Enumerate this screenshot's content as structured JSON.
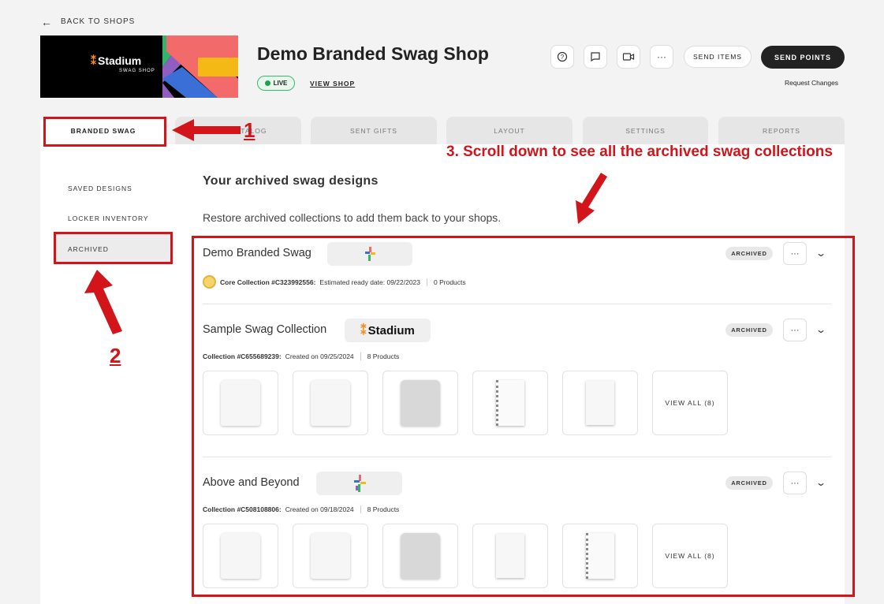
{
  "nav": {
    "back_label": "BACK TO SHOPS"
  },
  "shop": {
    "title": "Demo Branded Swag Shop",
    "status": "LIVE",
    "view_shop": "VIEW SHOP",
    "banner_logo": "Stadium",
    "banner_sub": "SWAG SHOP",
    "brand_colors": [
      "#4f9be0",
      "#f26a6a",
      "#f5b915",
      "#34b36b",
      "#8e5fc1",
      "#3b6fd8"
    ]
  },
  "header_actions": {
    "help_icon": "?",
    "chat_icon": "chat",
    "video_icon": "video",
    "more_icon": "···",
    "send_items": "SEND ITEMS",
    "send_points": "SEND POINTS",
    "request_changes": "Request Changes"
  },
  "tabs": [
    "BRANDED SWAG",
    "GIFT CATALOG",
    "SENT GIFTS",
    "LAYOUT",
    "SETTINGS",
    "REPORTS"
  ],
  "sidebar": {
    "items": [
      "SAVED DESIGNS",
      "LOCKER INVENTORY",
      "ARCHIVED"
    ]
  },
  "main": {
    "title": "Your archived swag designs",
    "subtitle": "Restore archived collections to add them back to your shops."
  },
  "collections": [
    {
      "name": "Demo Branded Swag",
      "badge": "ARCHIVED",
      "id_label": "Core Collection #C323992556:",
      "date_label": "Estimated ready date: 09/22/2023",
      "count_label": "0 Products"
    },
    {
      "name": "Sample Swag Collection",
      "logo": "Stadium",
      "badge": "ARCHIVED",
      "id_label": "Collection #C655689239:",
      "date_label": "Created on 09/25/2024",
      "count_label": "8 Products",
      "view_all": "VIEW ALL (8)"
    },
    {
      "name": "Above and Beyond",
      "badge": "ARCHIVED",
      "id_label": "Collection #C508108806:",
      "date_label": "Created on 09/18/2024",
      "count_label": "8 Products",
      "view_all": "VIEW ALL (8)"
    }
  ],
  "annotations": {
    "step1": "1",
    "step2": "2",
    "step3": "3. Scroll down to see all the archived swag collections",
    "color": "#d1151b"
  }
}
